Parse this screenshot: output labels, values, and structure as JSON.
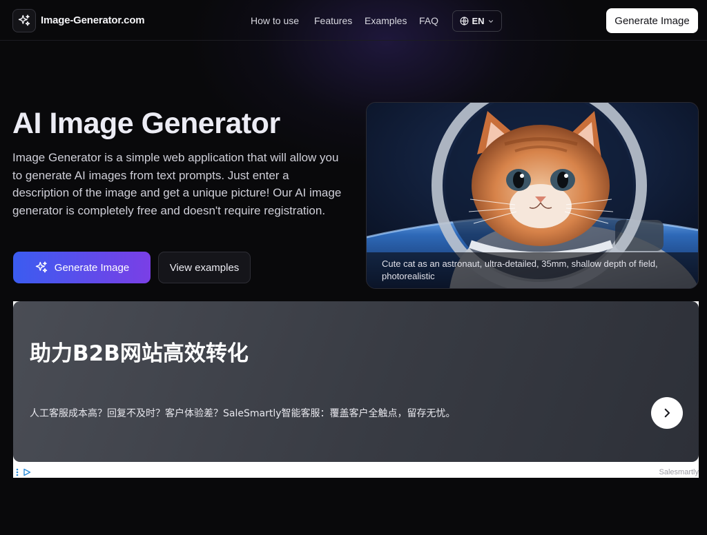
{
  "header": {
    "logo_icon": "sparkles-icon",
    "site_name": "Image-Generator.com",
    "nav": [
      "How to use",
      "Features",
      "Examples",
      "FAQ"
    ],
    "language": {
      "icon": "globe-icon",
      "label": "EN",
      "chevron": "chevron-down-icon"
    },
    "cta_label": "Generate Image"
  },
  "hero": {
    "title": "AI Image Generator",
    "description": "Image Generator is a simple web application that will allow you to generate AI images from text prompts. Just enter a description of the image and get a unique picture! Our AI image generator is completely free and doesn't require registration.",
    "primary_button": {
      "icon": "sparkles-icon",
      "label": "Generate Image"
    },
    "secondary_button": {
      "label": "View examples"
    },
    "example_image": {
      "caption": "Cute cat as an astronaut, ultra-detailed, 35mm, shallow depth of field, photorealistic"
    }
  },
  "ad": {
    "title": "助力B2B网站高效转化",
    "text": "人工客服成本高？回复不及时？客户体验差？SaleSmartly智能客服：覆盖客户全触点，留存无忧。",
    "arrow_icon": "chevron-right-icon",
    "brand": "Salesmartly",
    "footer_icons": [
      "more-vertical-icon",
      "adchoices-icon"
    ]
  },
  "colors": {
    "background": "#09090b",
    "primary_gradient_start": "#3b5cf0",
    "primary_gradient_end": "#7a3fe6",
    "cta_background": "#ffffff"
  }
}
